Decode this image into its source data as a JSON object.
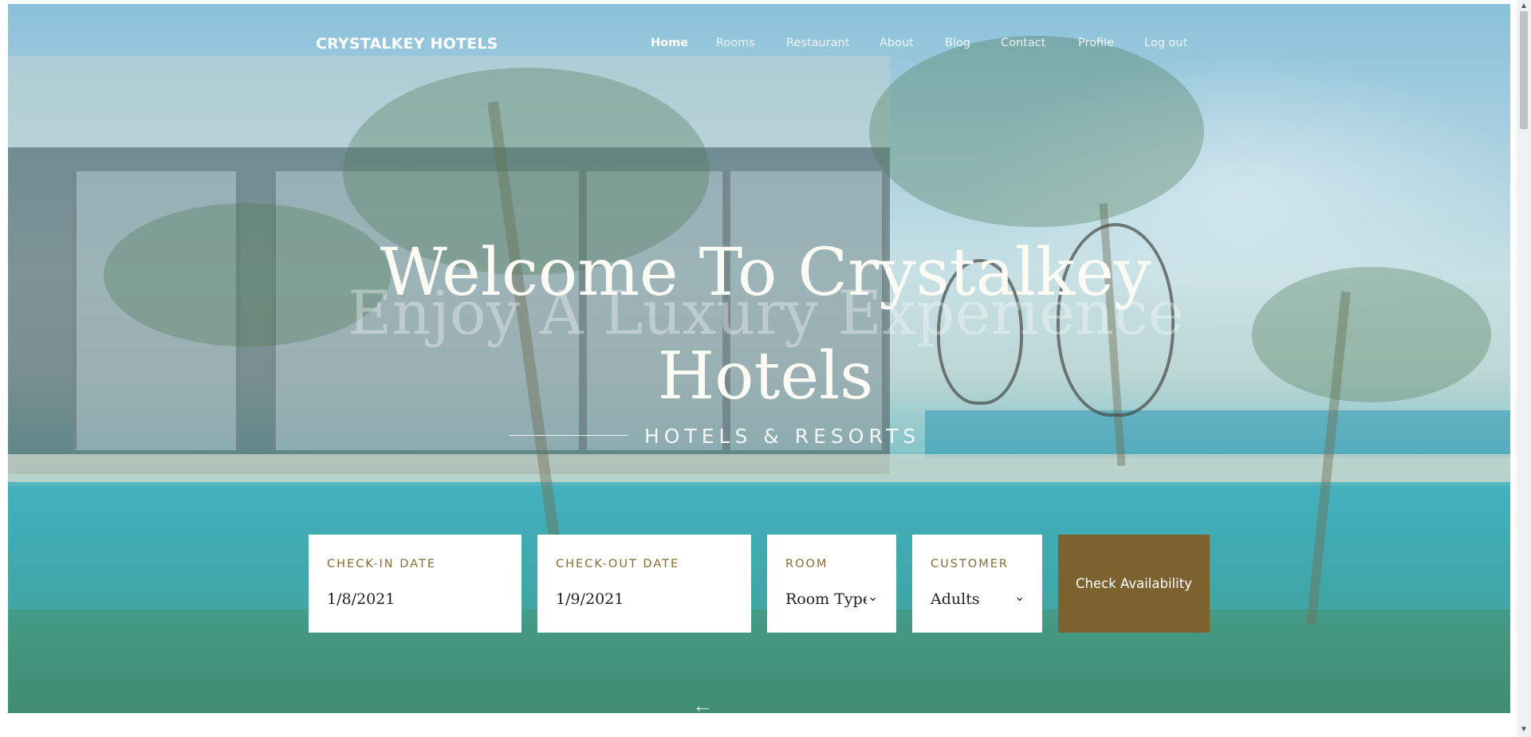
{
  "brand": "CRYSTALKEY HOTELS",
  "nav": [
    {
      "label": "Home",
      "active": true
    },
    {
      "label": "Rooms"
    },
    {
      "label": "Restaurant"
    },
    {
      "label": "About"
    },
    {
      "label": "Blog"
    },
    {
      "label": "Contact"
    },
    {
      "label": "Profile"
    },
    {
      "label": "Log out"
    }
  ],
  "hero": {
    "title": "Welcome To Crystalkey Hotels",
    "ghost_title": "Enjoy A Luxury Experience",
    "subtitle": "HOTELS & RESORTS"
  },
  "booking": {
    "checkin": {
      "label": "CHECK-IN DATE",
      "value": "1/8/2021"
    },
    "checkout": {
      "label": "CHECK-OUT DATE",
      "value": "1/9/2021"
    },
    "room": {
      "label": "ROOM",
      "value": "Room Type"
    },
    "customer": {
      "label": "CUSTOMER",
      "value": "Adults"
    },
    "submit": "Check Availability"
  },
  "icons": {
    "prev_arrow": "arrow-left-icon",
    "chevron": "chevron-down-icon"
  },
  "colors": {
    "accent": "#7d6230",
    "label": "#8a6a33"
  }
}
